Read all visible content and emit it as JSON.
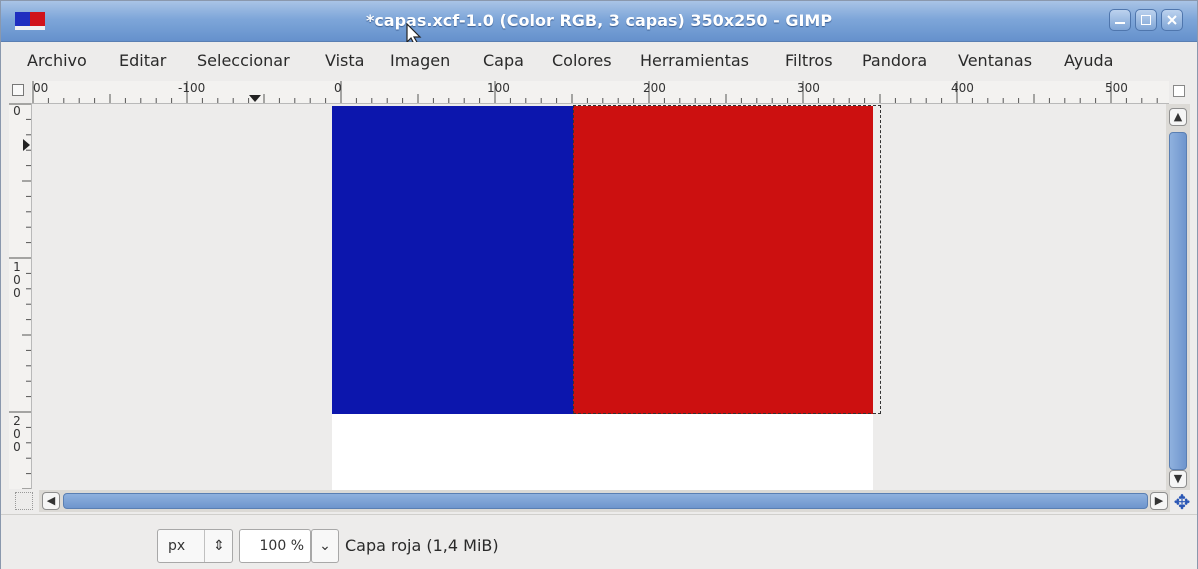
{
  "window": {
    "title": "*capas.xcf-1.0 (Color RGB, 3 capas) 350x250 - GIMP"
  },
  "menu": [
    "Archivo",
    "Editar",
    "Seleccionar",
    "Vista",
    "Imagen",
    "Capa",
    "Colores",
    "Herramientas",
    "Filtros",
    "Pandora",
    "Ventanas",
    "Ayuda"
  ],
  "ruler": {
    "h_labels": [
      "00",
      "-100",
      "0",
      "100",
      "200",
      "300",
      "400",
      "500"
    ],
    "v_labels": [
      "0",
      "100",
      "200"
    ]
  },
  "canvas": {
    "colors": {
      "blue_layer": "#0c16ad",
      "red_layer": "#cc1010",
      "background_layer": "#ffffff",
      "titlebar": "#7ea6d9"
    }
  },
  "status": {
    "unit": "px",
    "zoom": "100 %",
    "layer_info": "Capa roja (1,4 MiB)"
  },
  "icons": {
    "scroll_up": "▲",
    "scroll_down": "▼",
    "scroll_left": "◀",
    "scroll_right": "▶",
    "move": "✥",
    "spin": "⇕",
    "dropdown": "⌄"
  }
}
